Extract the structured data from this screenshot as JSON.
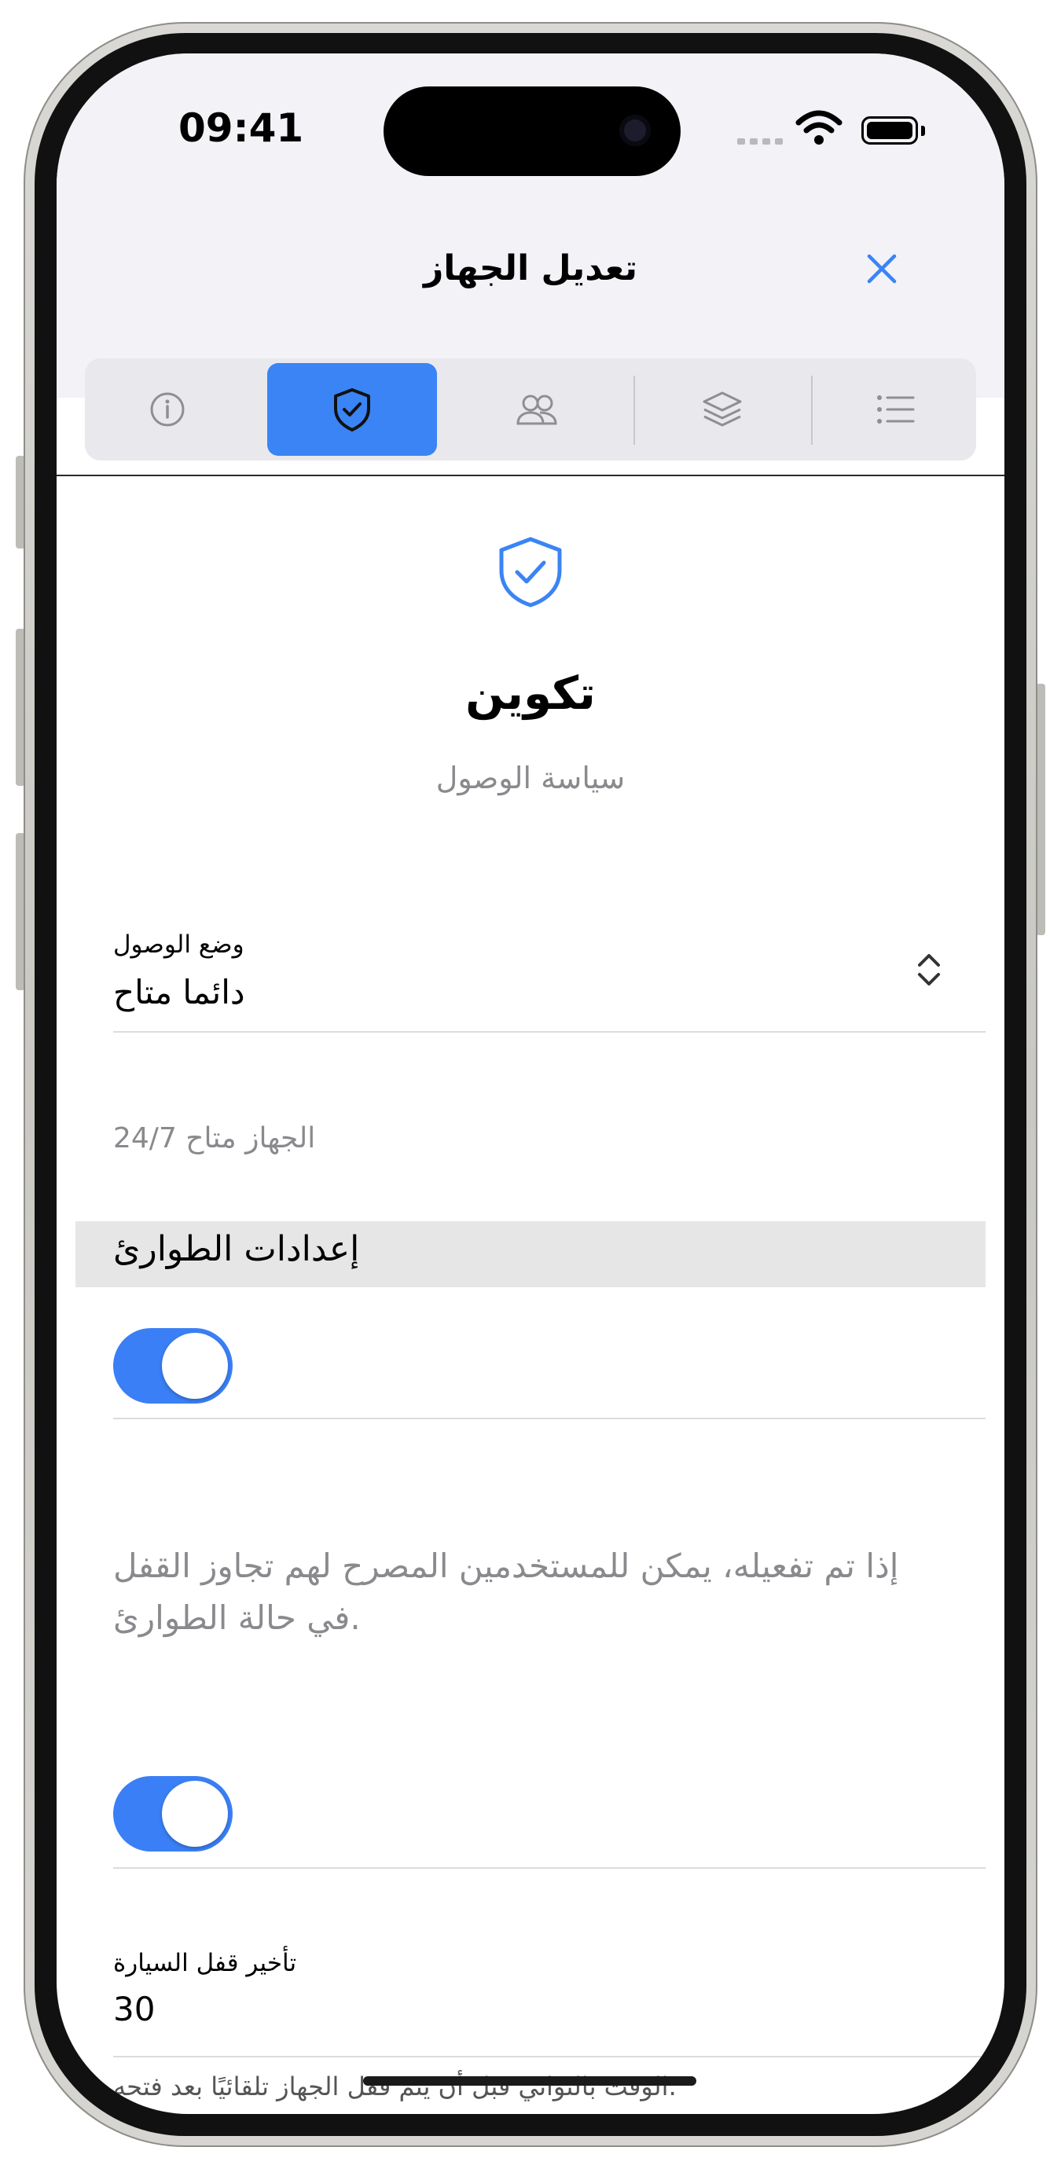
{
  "status_bar": {
    "time": "09:41"
  },
  "nav": {
    "title": "تعديل الجهاز",
    "close_icon": "close-icon"
  },
  "tabs": [
    {
      "icon": "info-icon",
      "selected": false
    },
    {
      "icon": "shield-check-icon",
      "selected": true
    },
    {
      "icon": "users-icon",
      "selected": false
    },
    {
      "icon": "layers-icon",
      "selected": false
    },
    {
      "icon": "list-icon",
      "selected": false
    }
  ],
  "hero": {
    "icon": "shield-check-icon",
    "title": "تكوين",
    "subtitle": "سياسة الوصول"
  },
  "access_mode": {
    "label": "وضع الوصول",
    "value": "دائما متاح",
    "helper": "الجهاز متاح 24/7"
  },
  "emergency": {
    "title": "إعدادات الطوارئ",
    "toggle1_on": true,
    "description": "إذا تم تفعيله، يمكن للمستخدمين المصرح لهم تجاوز القفل في حالة الطوارئ.",
    "toggle2_on": true
  },
  "lock_delay": {
    "label": "تأخير قفل السيارة",
    "value": "30",
    "helper": "الوقت بالثواني قبل أن يتم قفل الجهاز تلقائيًا بعد فتحه."
  },
  "colors": {
    "accent": "#3a84f5",
    "secondary_text": "#8a8a8e",
    "section_bg": "#e6e6e6"
  }
}
